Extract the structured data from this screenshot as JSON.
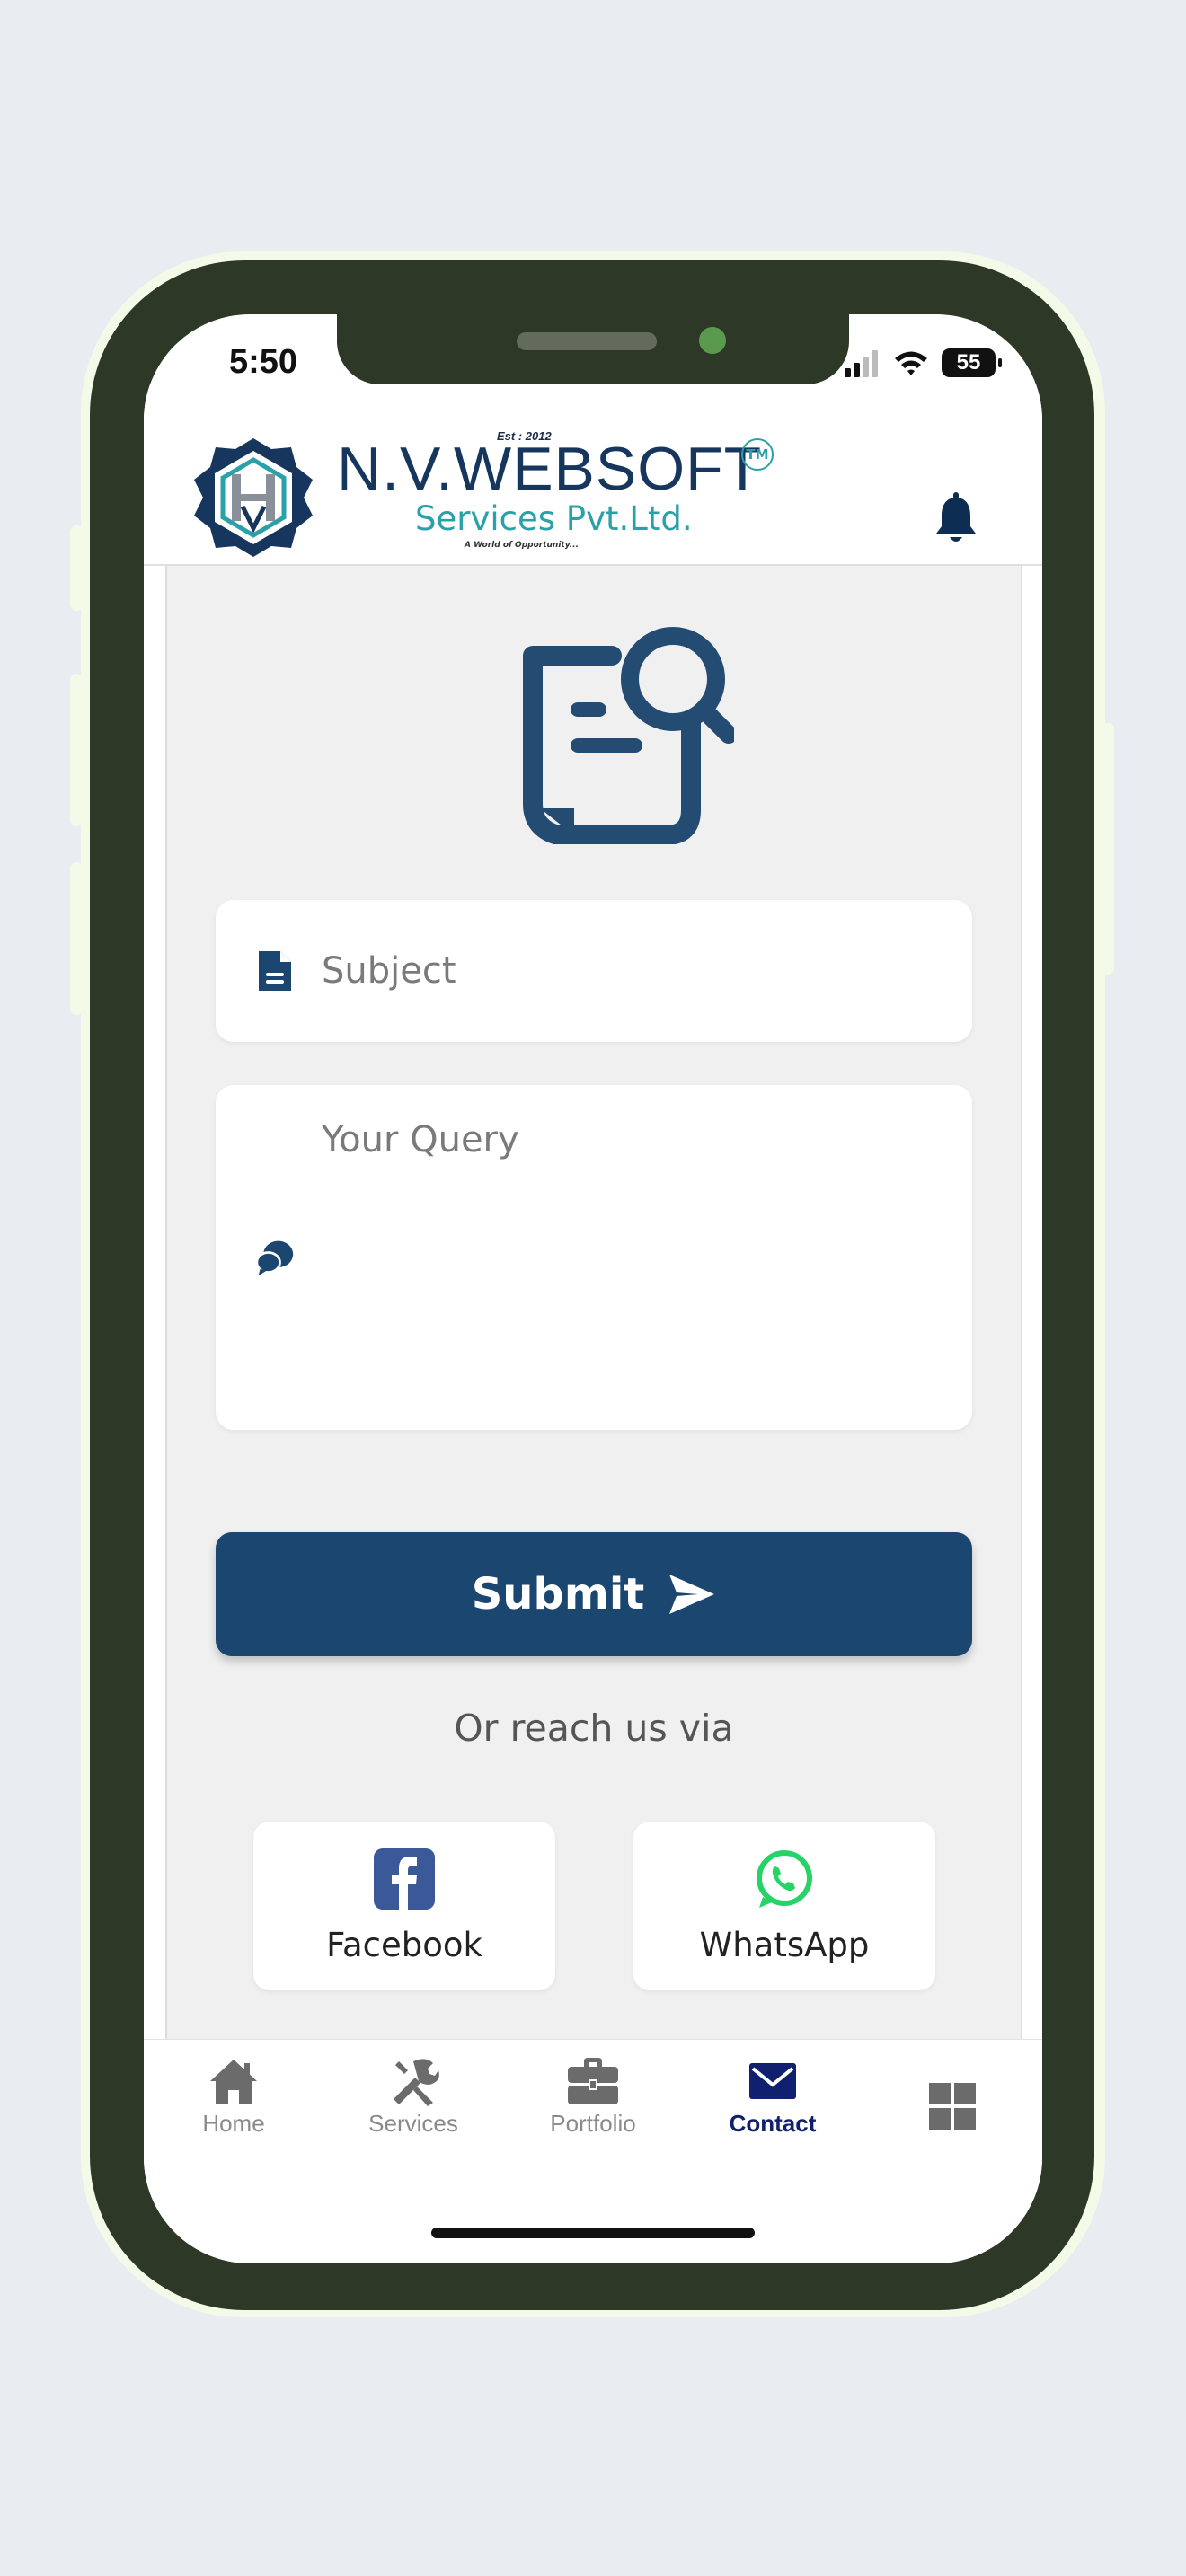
{
  "status_bar": {
    "time": "5:50",
    "battery": "55"
  },
  "header": {
    "brand": "N.V.WEBSOFT",
    "est": "Est : 2012",
    "tm": "TM",
    "subtitle": "Services Pvt.Ltd.",
    "tagline": "A World of Opportunity...",
    "notification_icon": "bell-icon"
  },
  "form": {
    "hero_icon": "document-search-icon",
    "subject_placeholder": "Subject",
    "subject_icon": "file-icon",
    "query_placeholder": "Your Query",
    "query_icon": "comment-icon",
    "submit_label": "Submit",
    "submit_icon": "paper-plane-icon"
  },
  "reach": {
    "label": "Or reach us via",
    "options": [
      {
        "label": "Facebook",
        "icon": "facebook-icon",
        "color": "#3b5998"
      },
      {
        "label": "WhatsApp",
        "icon": "whatsapp-icon",
        "color": "#25d366"
      }
    ]
  },
  "bottom_nav": {
    "items": [
      {
        "label": "Home",
        "icon": "home-icon"
      },
      {
        "label": "Services",
        "icon": "tools-icon"
      },
      {
        "label": "Portfolio",
        "icon": "briefcase-icon"
      },
      {
        "label": "Contact",
        "icon": "envelope-icon",
        "active": true
      },
      {
        "label": "",
        "icon": "grid-icon"
      }
    ]
  },
  "colors": {
    "primary": "#1b4670",
    "accent_teal": "#2aa0a8",
    "active_nav": "#10206e",
    "phone_frame": "#2d3826"
  }
}
